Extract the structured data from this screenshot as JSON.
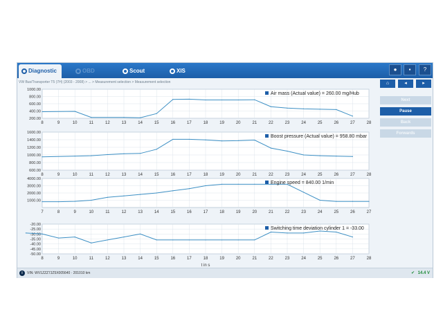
{
  "tabs": [
    {
      "label": "Diagnostic",
      "state": "active"
    },
    {
      "label": "OBD",
      "state": "dim"
    },
    {
      "label": "Scout",
      "state": "normal"
    },
    {
      "label": "XIS",
      "state": "normal"
    }
  ],
  "toolbar": {
    "circle_icon": "circle-icon",
    "chat_icon": "chat-icon",
    "help_label": "?"
  },
  "breadcrumb": "VW Bus/Transporter T5 (7H) (2003 - 2008) > ... > Measurement selection > Measurement selection",
  "side_buttons": [
    {
      "label": "Next",
      "enabled": false
    },
    {
      "label": "Pause",
      "enabled": true
    },
    {
      "label": "Back",
      "enabled": false
    },
    {
      "label": "Forwards",
      "enabled": false
    }
  ],
  "status": {
    "vin": "VIN: WV1ZZZ7JZ5X005640 · 201010 km",
    "voltage": "14.4 V"
  },
  "chart_data": [
    {
      "type": "line",
      "legend": "Air mass (Actual value) = 260.00 mg/Hub",
      "y_ticks": [
        "1000.00",
        "800.00",
        "600.00",
        "400.00",
        "200.00"
      ],
      "ylim": [
        200,
        1000
      ],
      "x": [
        8,
        10,
        11,
        13,
        14,
        15,
        16,
        17,
        18,
        19,
        20,
        21,
        22,
        23,
        24,
        25,
        26,
        27
      ],
      "values": [
        380,
        390,
        225,
        225,
        215,
        330,
        720,
        725,
        705,
        705,
        705,
        710,
        520,
        480,
        460,
        450,
        440,
        260
      ]
    },
    {
      "type": "line",
      "legend": "Boost pressure (Actual value) = 958.80 mbar",
      "y_ticks": [
        "1600.00",
        "1400.00",
        "1200.00",
        "1000.00",
        "800.00",
        "600.00"
      ],
      "ylim": [
        600,
        1600
      ],
      "x": [
        8,
        10,
        11,
        12,
        13,
        14,
        15,
        16,
        17,
        18,
        19,
        20,
        21,
        22,
        23,
        24,
        25,
        26,
        27
      ],
      "values": [
        950,
        970,
        980,
        1010,
        1030,
        1040,
        1150,
        1410,
        1410,
        1395,
        1370,
        1375,
        1390,
        1180,
        1100,
        1000,
        980,
        970,
        958.8
      ]
    },
    {
      "type": "line",
      "legend": "Engine speed = 840.00 1/min",
      "y_ticks": [
        "4000.00",
        "3000.00",
        "2000.00",
        "1000.00"
      ],
      "ylim": [
        0,
        4000
      ],
      "x": [
        7,
        8,
        9,
        10,
        11,
        12,
        13,
        14,
        15,
        16,
        17,
        18,
        19,
        20,
        21,
        22,
        23,
        24,
        25,
        26,
        27
      ],
      "values": [
        800,
        800,
        850,
        1000,
        1400,
        1600,
        1800,
        2000,
        2300,
        2600,
        3000,
        3200,
        3200,
        3200,
        3200,
        3200,
        2100,
        1000,
        840,
        840,
        840
      ]
    },
    {
      "type": "line",
      "legend": "Switching time deviation cylinder 1 = -33.00",
      "y_ticks": [
        "-20.00",
        "-25.00",
        "-30.00",
        "-35.00",
        "-40.00",
        "-45.00",
        "-50.00"
      ],
      "ylim": [
        -50,
        -20
      ],
      "x": [
        7,
        8,
        9,
        10,
        11,
        12,
        13,
        14,
        15,
        16,
        17,
        18,
        19,
        20,
        21,
        22,
        23,
        24,
        25,
        26,
        27
      ],
      "values": [
        -29,
        -30,
        -34,
        -33,
        -39,
        -36,
        -33,
        -30,
        -36,
        -36,
        -36,
        -36,
        -36,
        -36,
        -36,
        -28,
        -29,
        -29,
        -27,
        -28,
        -33
      ]
    }
  ],
  "x_ticks": [
    8,
    9,
    10,
    11,
    12,
    13,
    14,
    15,
    16,
    17,
    18,
    19,
    20,
    21,
    22,
    23,
    24,
    25,
    26,
    27,
    28
  ],
  "x_ticks_3": [
    7,
    8,
    9,
    10,
    11,
    12,
    13,
    14,
    15,
    16,
    17,
    18,
    19,
    20,
    21,
    22,
    23,
    24,
    25,
    26,
    27
  ],
  "xlabel": "t in s",
  "colors": {
    "line": "#3c8fc4",
    "grid": "#d3dde6",
    "accent": "#1d5ea8"
  }
}
